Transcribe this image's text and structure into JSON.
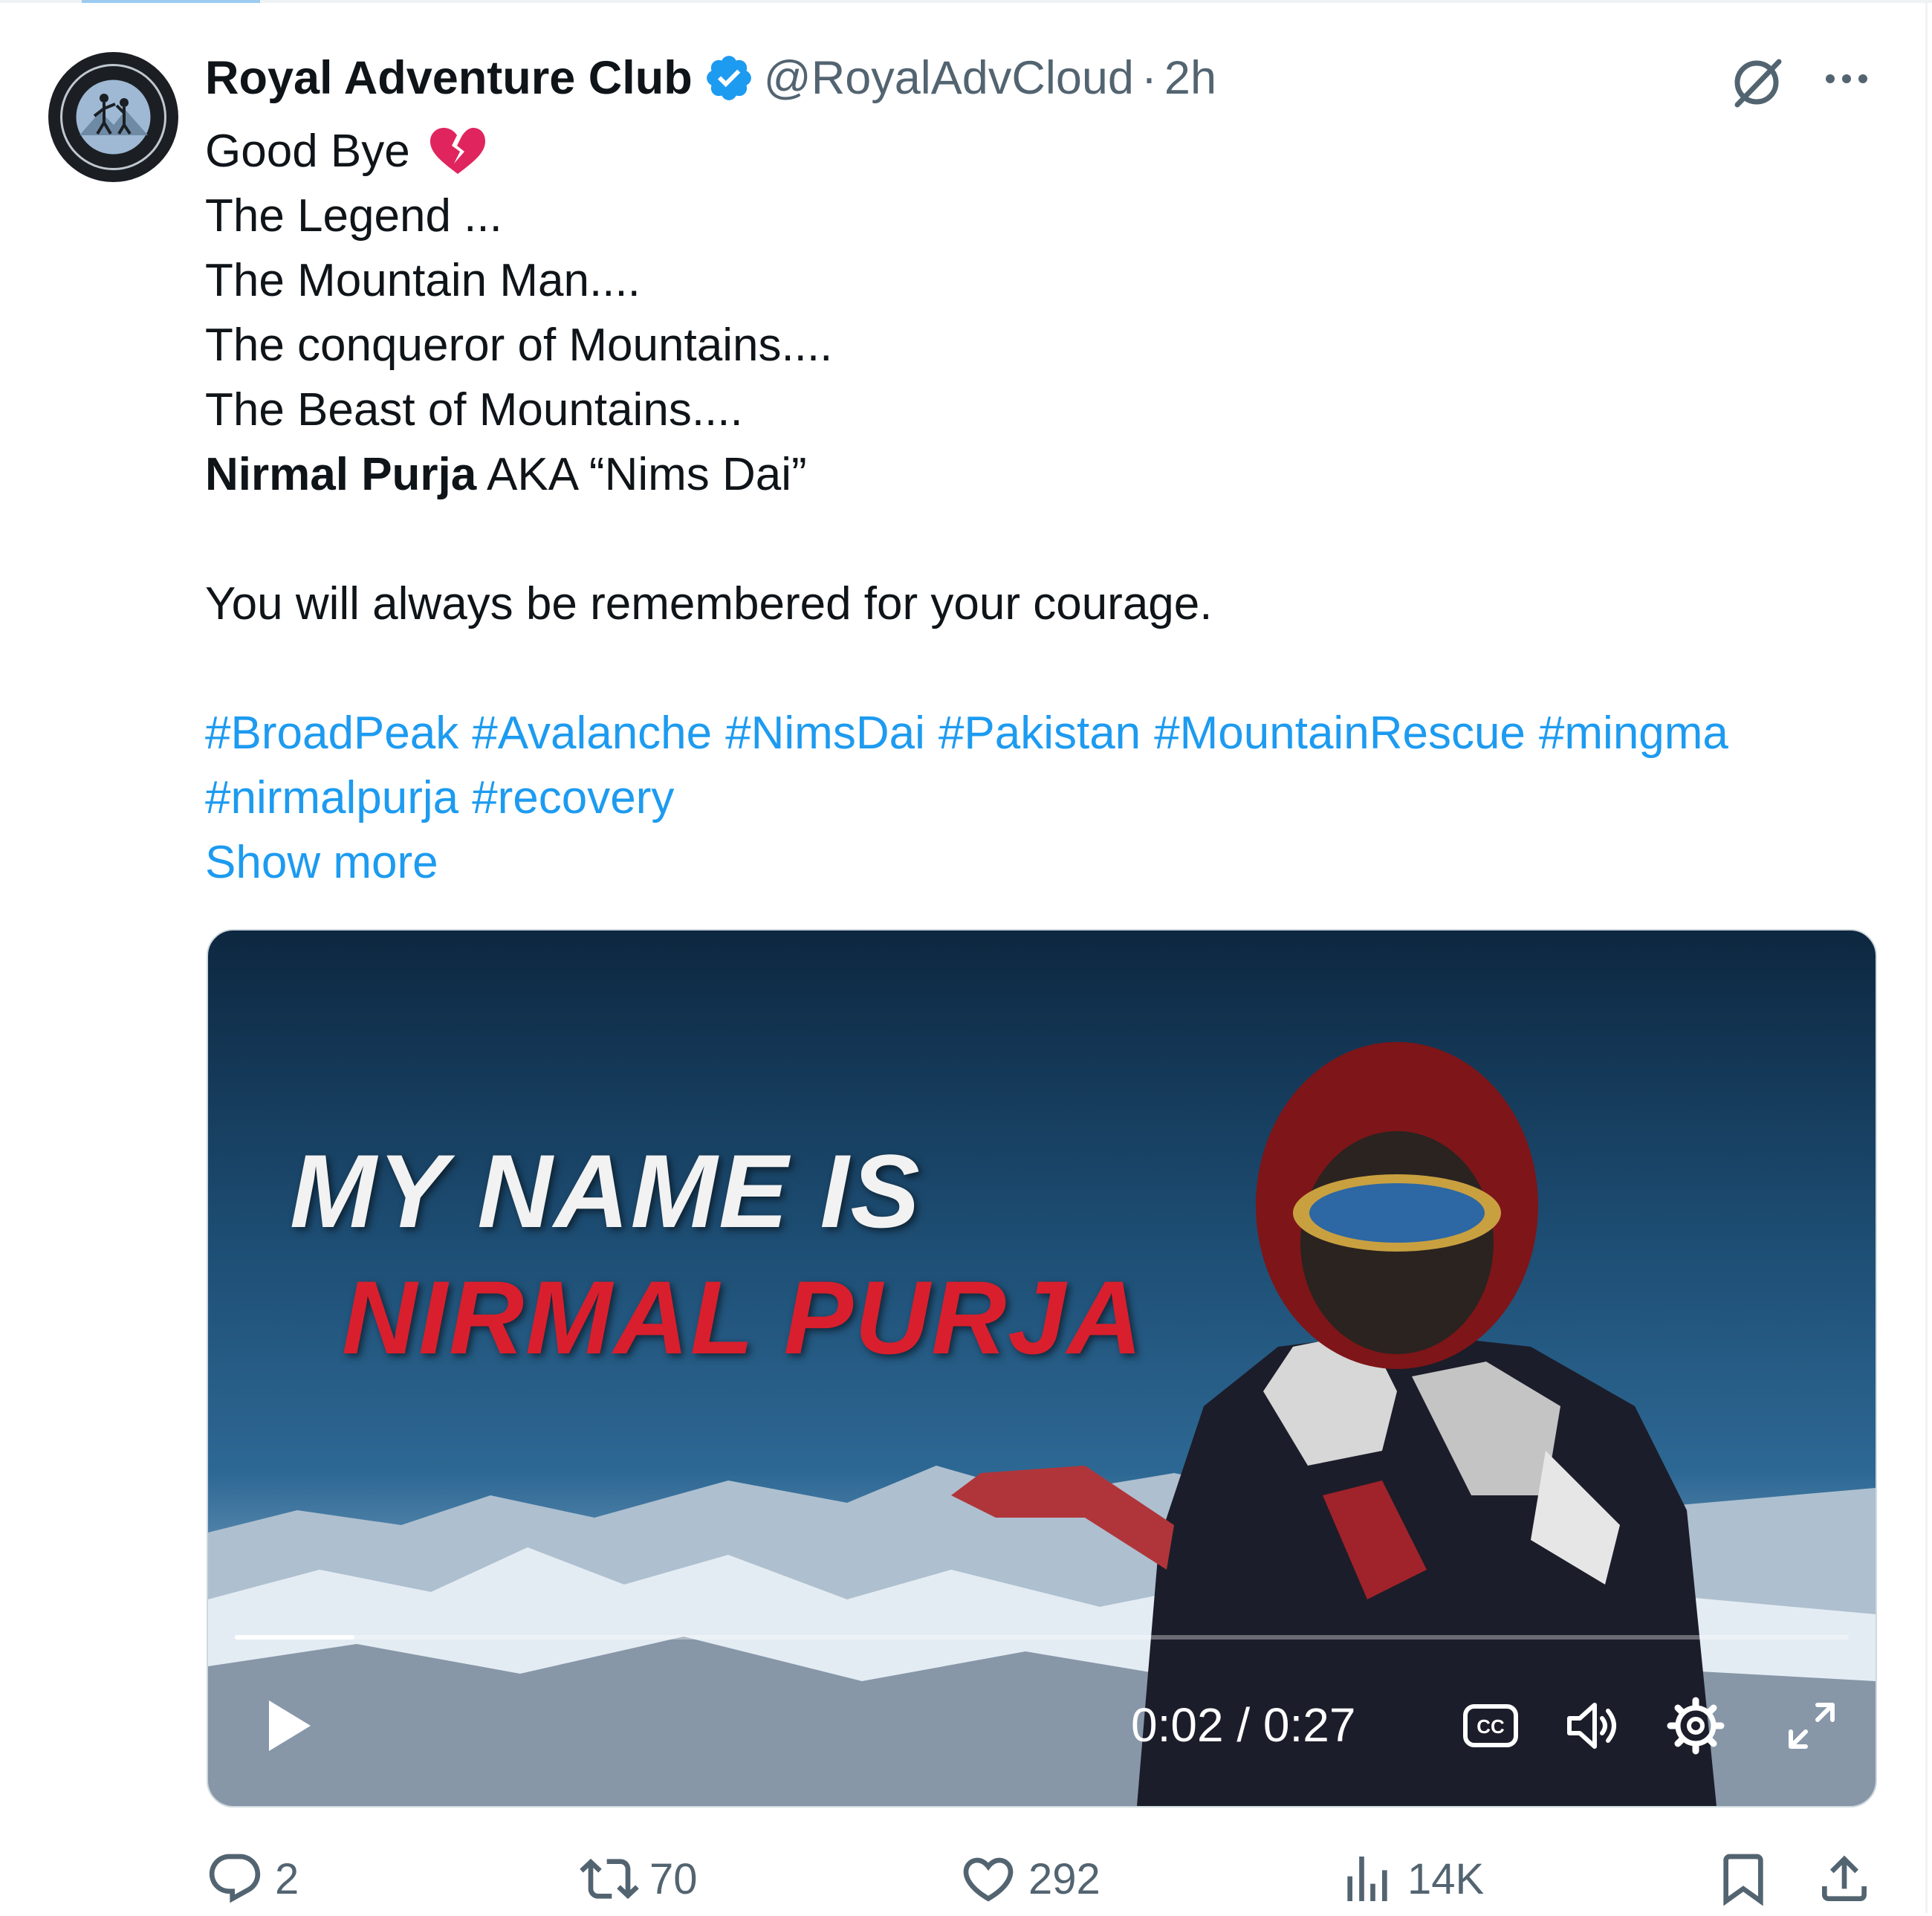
{
  "tweet": {
    "display_name": "Royal Adventure Club",
    "handle": "@RoyalAdvCloud",
    "separator": "·",
    "time": "2h",
    "lines": [
      "Good Bye",
      "The Legend ...",
      "The Mountain Man....",
      "The conqueror of Mountains....",
      "The Beast of Mountains....",
      "Nirmal Purja",
      " AKA “Nims Dai”",
      "You will always be remembered for your courage."
    ],
    "hashtags": [
      "#BroadPeak",
      "#Avalanche",
      "#NimsDai",
      "#Pakistan",
      "#MountainRescue",
      "#mingma",
      "#nirmalpurja",
      "#recovery"
    ],
    "show_more": "Show more"
  },
  "video": {
    "overlay_line1": "MY NAME IS",
    "overlay_line2": "NIRMAL PURJA",
    "current_time": "0:02",
    "duration": "0:27",
    "time_separator": " / ",
    "progress_fraction": 0.074
  },
  "actions": {
    "replies": "2",
    "reposts": "70",
    "likes": "292",
    "views": "14K"
  },
  "icons": {
    "verified": "verified-badge-icon",
    "grok": "grok-icon",
    "more": "more-icon",
    "heart_emoji": "broken-heart-icon",
    "reply": "reply-icon",
    "repost": "repost-icon",
    "like": "like-icon",
    "views": "views-icon",
    "bookmark": "bookmark-icon",
    "share": "share-icon"
  },
  "colors": {
    "link": "#1d9bf0",
    "secondary_text": "#536471",
    "primary_text": "#0f1419",
    "overlay_red": "#d91f2d",
    "broken_heart": "#e0245e"
  }
}
